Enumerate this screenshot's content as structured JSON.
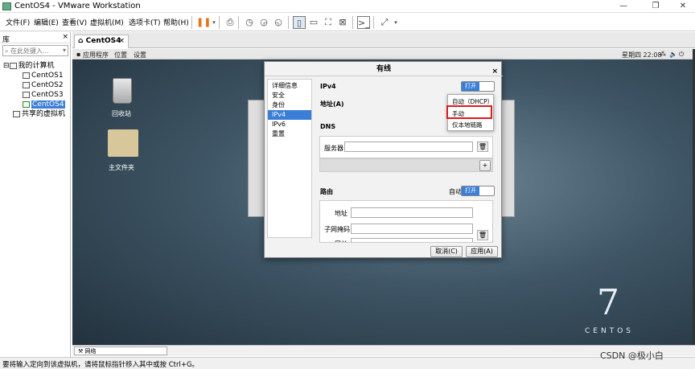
{
  "window": {
    "title": "CentOS4 - VMware Workstation",
    "controls": [
      "—",
      "❐",
      "✕"
    ]
  },
  "menubar": {
    "items": [
      "文件(F)",
      "编辑(E)",
      "查看(V)",
      "虚拟机(M)",
      "选项卡(T)",
      "帮助(H)"
    ]
  },
  "library": {
    "title": "库",
    "close": "×",
    "search_placeholder": "在此处键入...",
    "root": "我的计算机",
    "vms": [
      "CentOS1",
      "CentOS2",
      "CentOS3",
      "CentOS4"
    ],
    "selected_vm": "CentOS4",
    "shared": "共享的虚拟机"
  },
  "tab": {
    "label": "CentOS4",
    "close": "×"
  },
  "gnome_bar": {
    "apps": "应用程序",
    "places": "位置",
    "settings": "设置",
    "clock": "星期四 22:08"
  },
  "desktop": {
    "trash_label": "回收站",
    "home_label": "主文件夹",
    "logo_number": "7",
    "logo_word": "CENTOS"
  },
  "dialog": {
    "title": "有线",
    "close": "×",
    "sidebar": [
      "详细信息",
      "安全",
      "身份",
      "IPv4",
      "IPv6",
      "重置"
    ],
    "active_sidebar": "IPv4",
    "ipv4_header": "IPv4",
    "ipv4_toggle": "打开",
    "address_label": "地址(A)",
    "dns_label": "DNS",
    "server_label": "服务器",
    "add_symbol": "+",
    "routes_label": "路由",
    "routes_auto": "自动",
    "routes_toggle": "打开",
    "addr_field_label": "地址",
    "netmask_label": "子网掩码",
    "gateway_label": "网关",
    "cancel_button": "取消(C)",
    "apply_button": "应用(A)",
    "dropdown_options": [
      "自动（DHCP）",
      "手动",
      "仅本地链路"
    ],
    "highlighted_option": "手动"
  },
  "vm_status": {
    "network_label": "网络"
  },
  "statusbar": {
    "message": "要将输入定向到该虚拟机，请将鼠标指针移入其中或按 Ctrl+G。"
  },
  "watermark": "CSDN @极小白",
  "colors": {
    "accent": "#3b7ed7",
    "highlight_box": "#e0191c",
    "pause_orange": "#e8731a"
  }
}
